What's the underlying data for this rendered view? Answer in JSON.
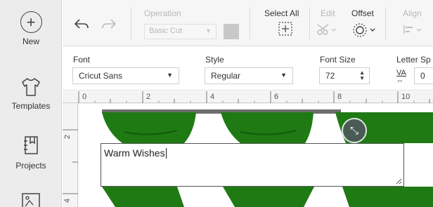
{
  "sidebar": {
    "items": [
      {
        "label": "New"
      },
      {
        "label": "Templates"
      },
      {
        "label": "Projects"
      },
      {
        "label": "Uploads"
      }
    ]
  },
  "toolbar": {
    "operation": {
      "label": "Operation",
      "value": "Basic Cut"
    },
    "select_all": {
      "label": "Select All"
    },
    "edit": {
      "label": "Edit"
    },
    "offset": {
      "label": "Offset"
    },
    "align": {
      "label": "Align"
    }
  },
  "properties": {
    "font": {
      "label": "Font",
      "value": "Cricut Sans"
    },
    "style": {
      "label": "Style",
      "value": "Regular"
    },
    "font_size": {
      "label": "Font Size",
      "value": "72"
    },
    "letter_spacing": {
      "label": "Letter Sp",
      "value": "0",
      "icon_text": "VA"
    }
  },
  "canvas": {
    "ruler_h": [
      "0",
      "2",
      "4",
      "6",
      "8",
      "10"
    ],
    "ruler_v": [
      "2",
      "4"
    ],
    "text_value": "Warm Wishes"
  },
  "colors": {
    "design_fill": "#1f7a13",
    "sidebar_bg": "#ececec"
  }
}
